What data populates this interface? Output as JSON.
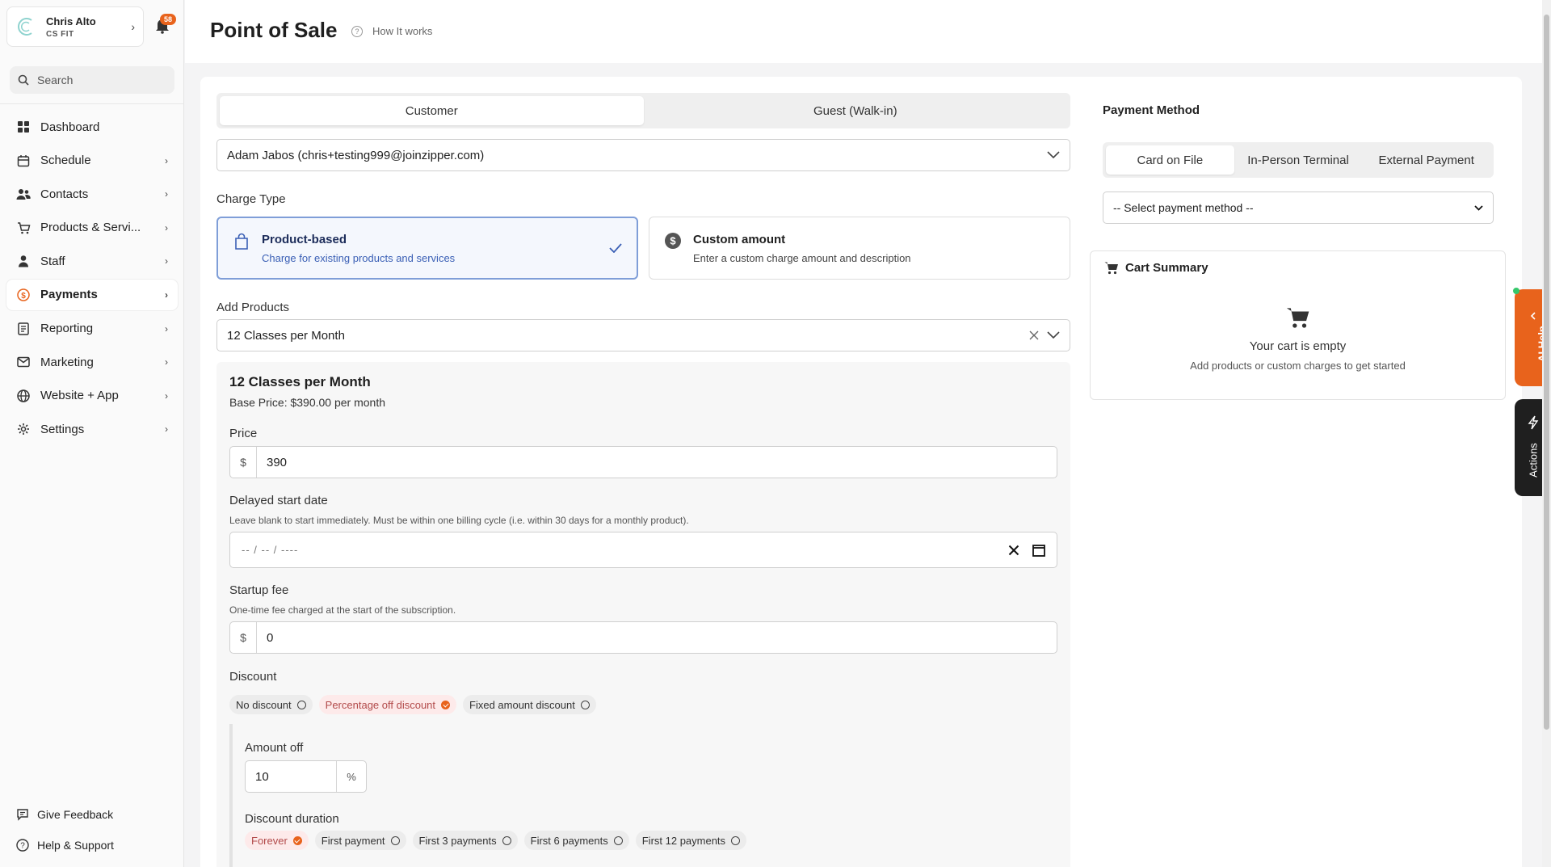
{
  "account": {
    "name": "Chris Alto",
    "org": "CS FIT"
  },
  "notifications": {
    "count": "58"
  },
  "search": {
    "placeholder": "Search"
  },
  "nav": [
    {
      "label": "Dashboard",
      "icon": "dashboard-icon",
      "chevron": ""
    },
    {
      "label": "Schedule",
      "icon": "calendar-icon",
      "chevron": "›"
    },
    {
      "label": "Contacts",
      "icon": "contacts-icon",
      "chevron": "›"
    },
    {
      "label": "Products & Servi...",
      "icon": "cart-icon",
      "chevron": "›"
    },
    {
      "label": "Staff",
      "icon": "staff-icon",
      "chevron": "›"
    },
    {
      "label": "Payments",
      "icon": "payments-icon",
      "chevron": "›"
    },
    {
      "label": "Reporting",
      "icon": "reporting-icon",
      "chevron": "›"
    },
    {
      "label": "Marketing",
      "icon": "mail-icon",
      "chevron": "›"
    },
    {
      "label": "Website + App",
      "icon": "globe-icon",
      "chevron": "›"
    },
    {
      "label": "Settings",
      "icon": "gear-icon",
      "chevron": "›"
    }
  ],
  "footer": {
    "feedback": "Give Feedback",
    "help": "Help & Support"
  },
  "header": {
    "title": "Point of Sale",
    "how_it_works": "How It works"
  },
  "customer_tabs": {
    "customer": "Customer",
    "guest": "Guest (Walk-in)"
  },
  "customer_select": {
    "value": "Adam Jabos (chris+testing999@joinzipper.com)"
  },
  "charge_type": {
    "label": "Charge Type",
    "product": {
      "title": "Product-based",
      "desc": "Charge for existing products and services"
    },
    "custom": {
      "title": "Custom amount",
      "desc": "Enter a custom charge amount and description"
    }
  },
  "add_products": {
    "label": "Add Products",
    "value": "12 Classes per Month"
  },
  "product": {
    "name": "12 Classes per Month",
    "base_price": "Base Price: $390.00 per month",
    "price_label": "Price",
    "price_prefix": "$",
    "price_value": "390",
    "delayed_label": "Delayed start date",
    "delayed_help": "Leave blank to start immediately. Must be within one billing cycle (i.e. within 30 days for a monthly product).",
    "date_placeholder": "-- /  -- /  ----",
    "startup_label": "Startup fee",
    "startup_help": "One-time fee charged at the start of the subscription.",
    "startup_prefix": "$",
    "startup_value": "0",
    "discount_label": "Discount",
    "discount_options": [
      "No discount",
      "Percentage off discount",
      "Fixed amount discount"
    ],
    "amount_off_label": "Amount off",
    "amount_off_value": "10",
    "amount_off_unit": "%",
    "duration_label": "Discount duration",
    "duration_options": [
      "Forever",
      "First payment",
      "First 3 payments",
      "First 6 payments",
      "First 12 payments"
    ]
  },
  "payment": {
    "title": "Payment Method",
    "tabs": [
      "Card on File",
      "In-Person Terminal",
      "External Payment"
    ],
    "select_value": "-- Select payment method --"
  },
  "cart": {
    "title": "Cart Summary",
    "empty": "Your cart is empty",
    "empty_sub": "Add products or custom charges to get started"
  },
  "side_tabs": {
    "ai_help": "AI Help",
    "actions": "Actions"
  },
  "colors": {
    "accent": "#e8631c",
    "selected_border": "#7f9ed8",
    "selected_bg": "#f4f7fd",
    "dark": "#1f1f1f"
  }
}
